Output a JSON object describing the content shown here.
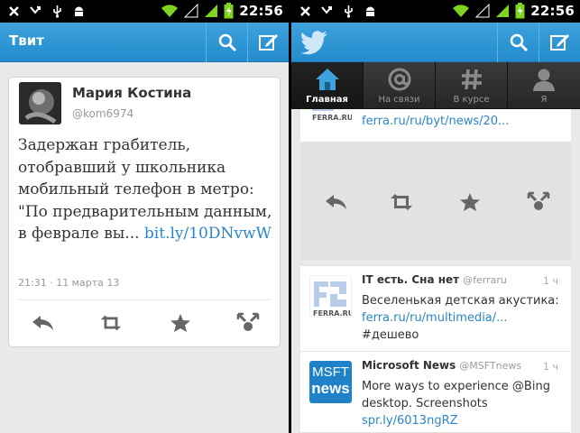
{
  "status_bar": {
    "time": "22:56"
  },
  "left": {
    "action_bar": {
      "title": "Твит"
    },
    "tweet": {
      "author_name": "Мария Костина",
      "author_handle": "@kom6974",
      "text_main": "Задержан грабитель, отобравший у школьника мобильный телефон в метро: \"По предварительным данным, в феврале вы... ",
      "text_link": "bit.ly/10DNvwW",
      "timestamp": "21:31 · 11 марта 13"
    }
  },
  "right": {
    "tabs": [
      {
        "label": "Главная",
        "icon": "home-icon",
        "active": true
      },
      {
        "label": "На связи",
        "icon": "at-icon",
        "active": false
      },
      {
        "label": "В курсе",
        "icon": "hash-icon",
        "active": false
      },
      {
        "label": "Я",
        "icon": "person-icon",
        "active": false
      }
    ],
    "tweets": [
      {
        "link": "ferra.ru/ru/byt/news/20..."
      },
      {
        "name": "IT есть. Сна нет",
        "handle": "@ferraru",
        "time": "1 ч",
        "text": "Веселенькая детская акустика:",
        "link": "ferra.ru/ru/multimedia/...",
        "text_after": "#дешево"
      },
      {
        "name": "Microsoft News",
        "handle": "@MSFTnews",
        "time": "1 ч",
        "text": "More ways to experience @Bing desktop.  Screenshots",
        "link": "spr.ly/6013ngRZ",
        "avatar_text_1": "MSFT",
        "avatar_text_2": "news"
      }
    ],
    "ferra_logo_text": "FERRA.RU"
  },
  "colors": {
    "accent": "#2a86c8",
    "action_bar": "#238ccd",
    "tab_bar": "#2c2c2c"
  }
}
